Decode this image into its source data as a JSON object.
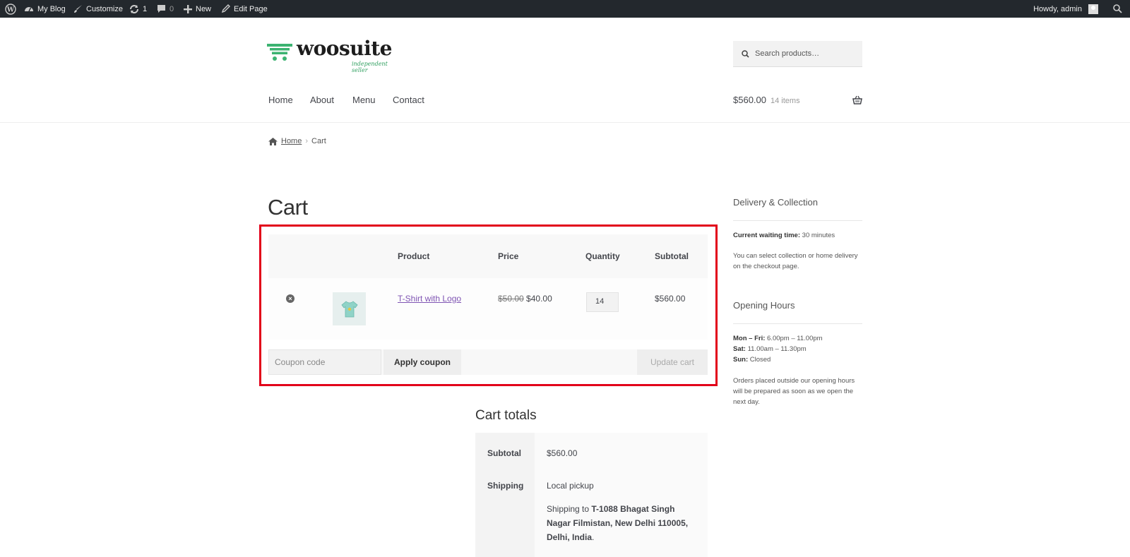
{
  "adminbar": {
    "site_name": "My Blog",
    "customize": "Customize",
    "updates_count": "1",
    "comments_count": "0",
    "new_label": "New",
    "edit_page": "Edit Page",
    "howdy": "Howdy, admin"
  },
  "header": {
    "logo_name": "woosuite",
    "logo_tagline": "independent seller",
    "search_placeholder": "Search products…",
    "nav": [
      "Home",
      "About",
      "Menu",
      "Contact"
    ],
    "cart_total": "$560.00",
    "cart_items": "14 items",
    "logo_color": "#3cb371"
  },
  "breadcrumb": {
    "home": "Home",
    "current": "Cart"
  },
  "page_title": "Cart",
  "cart_table": {
    "headers": {
      "product": "Product",
      "price": "Price",
      "quantity": "Quantity",
      "subtotal": "Subtotal"
    },
    "row": {
      "remove_icon": "close-circle-icon",
      "product_name": "T-Shirt with Logo",
      "regular_price": "$50.00",
      "sale_price": "$40.00",
      "quantity": "14",
      "subtotal": "$560.00"
    },
    "coupon_placeholder": "Coupon code",
    "apply_coupon": "Apply coupon",
    "update_cart": "Update cart",
    "link_color": "#7f54b3",
    "highlight_color": "#e2001a"
  },
  "cart_totals": {
    "title": "Cart totals",
    "subtotal_label": "Subtotal",
    "subtotal_value": "$560.00",
    "shipping_label": "Shipping",
    "shipping_method": "Local pickup",
    "shipping_prefix": "Shipping to ",
    "shipping_address": "T-1088 Bhagat Singh Nagar Filmistan, New Delhi 110005, Delhi, India",
    "shipping_suffix": "."
  },
  "sidebar": {
    "delivery_title": "Delivery & Collection",
    "waiting_label": "Current waiting time:",
    "waiting_value": " 30 minutes",
    "delivery_note": "You can select collection or home delivery on the checkout page.",
    "hours_title": "Opening Hours",
    "hours": [
      {
        "day": "Mon – Fri:",
        "time": " 6.00pm – 11.00pm"
      },
      {
        "day": "Sat:",
        "time": " 11.00am – 11.30pm"
      },
      {
        "day": "Sun:",
        "time": " Closed"
      }
    ],
    "hours_note": "Orders placed outside our opening hours will be prepared as soon as we open the next day."
  }
}
